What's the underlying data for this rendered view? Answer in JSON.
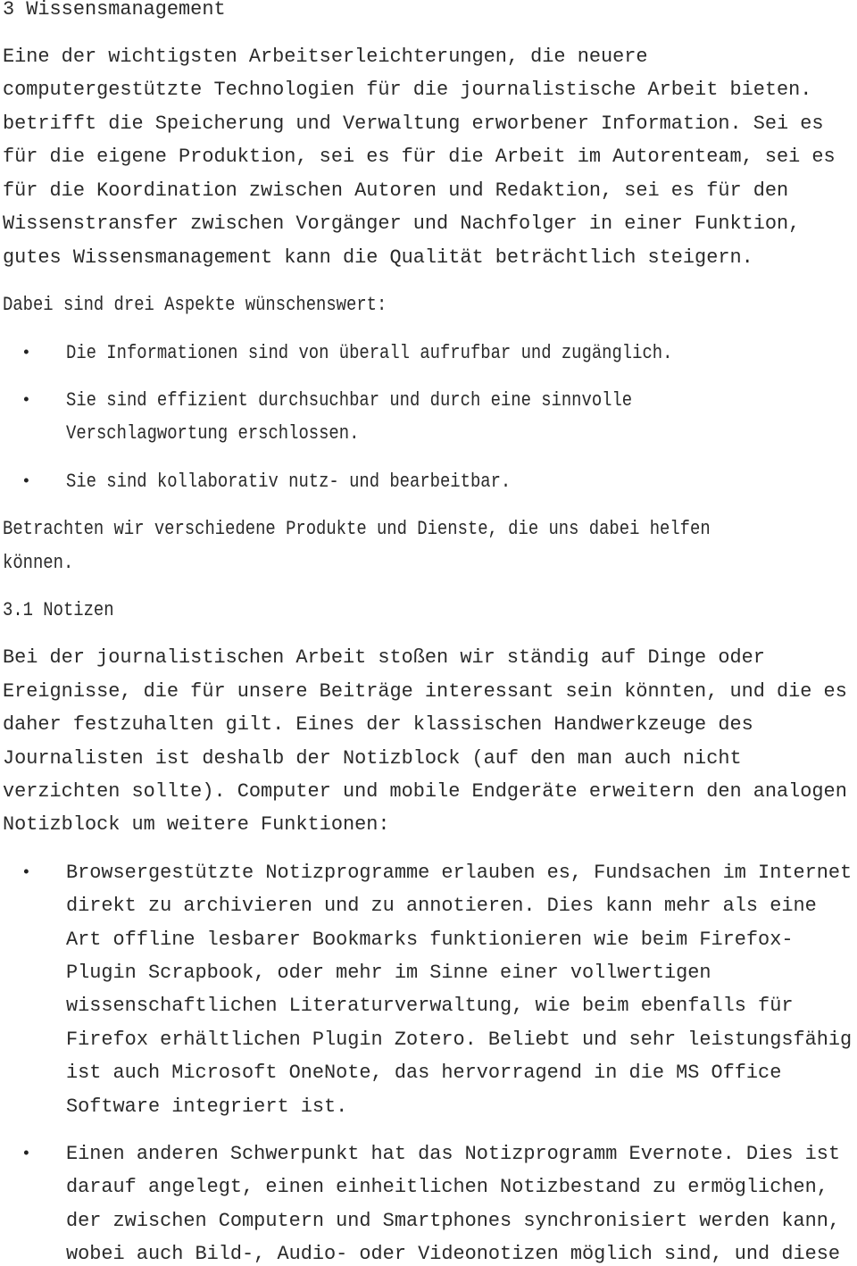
{
  "document": {
    "heading": "3 Wissensmanagement",
    "intro_paragraph": [
      "Eine der wichtigsten Arbeitserleichterungen, die neuere",
      "computergestützte Technologien für die journalistische Arbeit bieten.",
      "betrifft die Speicherung und Verwaltung erworbener Information. Sei es",
      "für die eigene Produktion, sei es für die Arbeit im Autorenteam, sei es",
      "für die Koordination zwischen Autoren und Redaktion, sei es für den",
      "Wissenstransfer zwischen Vorgänger und Nachfolger in einer Funktion,",
      "gutes Wissensmanagement kann die Qualität beträchtlich steigern."
    ],
    "aspects_intro": "Dabei sind drei Aspekte wünschenswert:",
    "aspects": [
      {
        "lines": [
          "Die Informationen sind von überall aufrufbar und zugänglich."
        ]
      },
      {
        "lines": [
          "Sie sind effizient durchsuchbar und durch eine sinnvolle",
          "Verschlagwortung erschlossen."
        ]
      },
      {
        "lines": [
          "Sie sind kollaborativ nutz- und bearbeitbar."
        ]
      }
    ],
    "transition_paragraph": [
      "Betrachten wir verschiedene Produkte und Dienste, die uns dabei helfen",
      "können."
    ],
    "subheading": "3.1 Notizen",
    "notizen_paragraph": [
      "Bei der journalistischen Arbeit stoßen wir ständig auf Dinge oder",
      "Ereignisse, die für unsere Beiträge interessant sein könnten, und die es",
      "daher festzuhalten gilt. Eines der klassischen Handwerkzeuge des",
      "Journalisten ist deshalb der Notizblock (auf den man auch nicht",
      "verzichten sollte). Computer und mobile Endgeräte erweitern den analogen",
      "Notizblock um weitere Funktionen:"
    ],
    "functions": [
      {
        "lines": [
          "Browsergestützte Notizprogramme erlauben es, Fundsachen im Internet",
          "direkt zu archivieren und zu annotieren. Dies kann mehr als eine",
          "Art offline lesbarer Bookmarks funktionieren wie beim Firefox-",
          "Plugin Scrapbook, oder mehr im Sinne einer vollwertigen",
          "wissenschaftlichen Literaturverwaltung, wie beim ebenfalls für",
          "Firefox erhältlichen Plugin Zotero. Beliebt und sehr leistungsfähig",
          "ist auch Microsoft OneNote, das hervorragend in die MS Office",
          "Software integriert ist."
        ]
      },
      {
        "lines": [
          "Einen anderen Schwerpunkt hat das Notizprogramm Evernote. Dies ist",
          "darauf angelegt, einen einheitlichen Notizbestand zu ermöglichen,",
          "der zwischen Computern und Smartphones synchronisiert werden kann,",
          "wobei auch Bild-, Audio- oder Videonotizen möglich sind, und diese"
        ]
      }
    ],
    "bullet_glyph": "•"
  }
}
